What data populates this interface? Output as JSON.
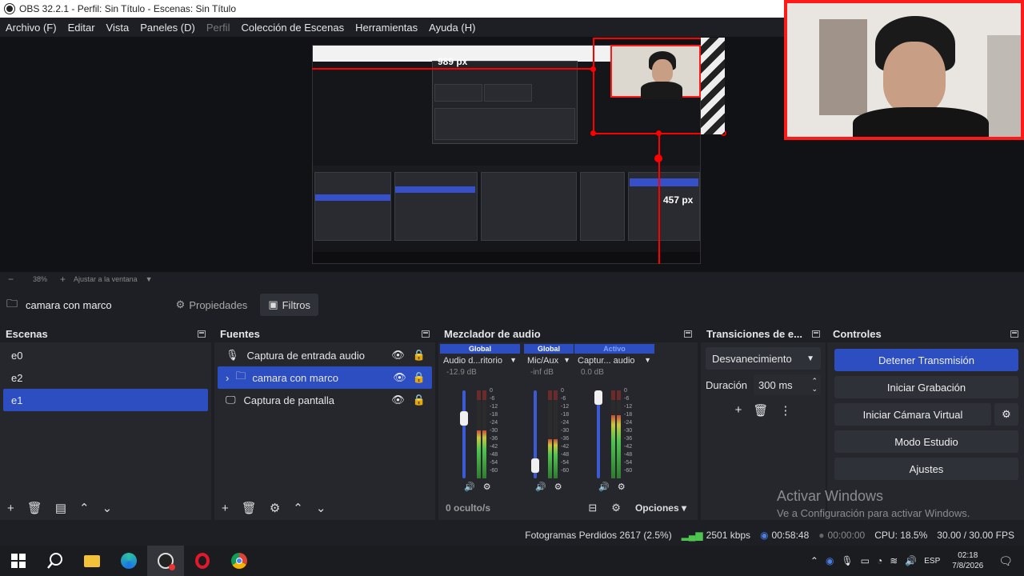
{
  "titlebar": {
    "title": "OBS 32.2.1 - Perfil: Sin Título - Escenas: Sin Título"
  },
  "menu": {
    "items": [
      "Archivo (F)",
      "Editar",
      "Vista",
      "Paneles (D)",
      "Perfil",
      "Colección de Escenas",
      "Herramientas",
      "Ayuda (H)"
    ],
    "disabled_item": "Perfil"
  },
  "preview": {
    "hud_width": "989 px",
    "hud_height": "457 px"
  },
  "zoombar": {
    "minus": "−",
    "zoom": "38%",
    "plus": "+",
    "fit": "Ajustar a la ventana"
  },
  "source_toolbar": {
    "name": "camara con marco",
    "props": "Propiedades",
    "filters": "Filtros"
  },
  "scenes": {
    "title": "Escenas",
    "items": [
      "e0",
      "e2",
      "e1"
    ],
    "selected": 2
  },
  "sources": {
    "title": "Fuentes",
    "items": [
      {
        "label": "Captura de entrada audio",
        "icon": "microphone-icon"
      },
      {
        "label": "camara con marco",
        "icon": "folder-icon"
      },
      {
        "label": "Captura de pantalla",
        "icon": "monitor-icon"
      }
    ],
    "selected": 1
  },
  "mixer": {
    "title": "Mezclador de audio",
    "channels": [
      {
        "tag": "Global",
        "name": "Audio d...ritorio",
        "db": "-12.9 dB",
        "level": 0.55,
        "fader": 0.72
      },
      {
        "tag": "Global",
        "name": "Mic/Aux",
        "db": "-inf dB",
        "level": 0.45,
        "fader": 0.08
      },
      {
        "tag": "Activo",
        "name": "Captur... audio",
        "db": "0.0 dB",
        "level": 0.72,
        "fader": 1.0
      }
    ],
    "ticks": [
      "0",
      "-6",
      "-12",
      "-18",
      "-24",
      "-30",
      "-36",
      "-42",
      "-48",
      "-54",
      "-60"
    ],
    "hidden": "0 oculto/s",
    "options": "Opciones"
  },
  "transitions": {
    "title": "Transiciones de e...",
    "selected": "Desvanecimiento",
    "duration_label": "Duración",
    "duration_value": "300 ms"
  },
  "controls": {
    "title": "Controles",
    "stream": "Detener Transmisión",
    "record": "Iniciar Grabación",
    "virtualcam": "Iniciar Cámara Virtual",
    "studio": "Modo Estudio",
    "settings": "Ajustes"
  },
  "status": {
    "dropped": "Fotogramas Perdidos 2617 (2.5%)",
    "bitrate": "2501 kbps",
    "stream_time": "00:58:48",
    "rec_time": "00:00:00",
    "cpu": "CPU: 18.5%",
    "fps": "30.00 / 30.00 FPS"
  },
  "watermark": {
    "line1": "Activar Windows",
    "line2": "Ve a Configuración para activar Windows."
  },
  "taskbar": {
    "lang": "ESP",
    "time": "02:18",
    "date": "7/8/2026"
  },
  "colors": {
    "accent": "#2c4ec0",
    "red": "#ff1a1a",
    "meter_green": "#4ec54e"
  }
}
